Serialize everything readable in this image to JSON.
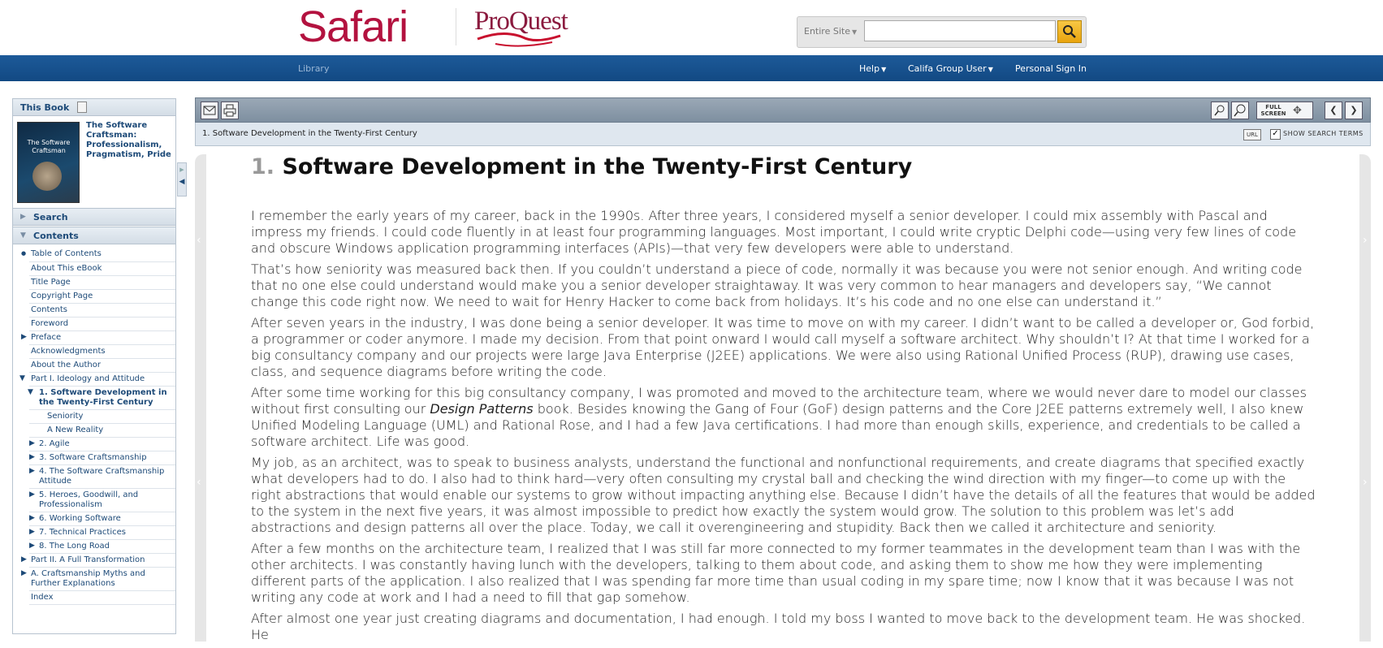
{
  "header": {
    "logo_safari": "Safari",
    "logo_proquest": "ProQuest",
    "search_scope": "Entire Site",
    "search_placeholder": ""
  },
  "nav": {
    "library": "Library",
    "help": "Help",
    "group": "Califa Group User",
    "signin": "Personal Sign In"
  },
  "sidebar": {
    "this_book": "This Book",
    "cover_title": "The Software Craftsman",
    "book_title": "The Software Craftsman: Professionalism, Pragmatism, Pride",
    "search_label": "Search",
    "contents_label": "Contents",
    "toc": [
      {
        "label": "Table of Contents"
      },
      {
        "label": "About This eBook"
      },
      {
        "label": "Title Page"
      },
      {
        "label": "Copyright Page"
      },
      {
        "label": "Contents"
      },
      {
        "label": "Foreword"
      },
      {
        "label": "Preface"
      },
      {
        "label": "Acknowledgments"
      },
      {
        "label": "About the Author"
      },
      {
        "label": "Part I. Ideology and Attitude"
      },
      {
        "label": "1. Software Development in the Twenty-First Century"
      },
      {
        "label": "Seniority"
      },
      {
        "label": "A New Reality"
      },
      {
        "label": "2. Agile"
      },
      {
        "label": "3. Software Craftsmanship"
      },
      {
        "label": "4. The Software Craftsmanship Attitude"
      },
      {
        "label": "5. Heroes, Goodwill, and Professionalism"
      },
      {
        "label": "6. Working Software"
      },
      {
        "label": "7. Technical Practices"
      },
      {
        "label": "8. The Long Road"
      },
      {
        "label": "Part II. A Full Transformation"
      },
      {
        "label": "A. Craftsmanship Myths and Further Explanations"
      },
      {
        "label": "Index"
      }
    ]
  },
  "toolbar": {
    "fullscreen": "FULL SCREEN",
    "breadcrumb": "1. Software Development in the Twenty-First Century",
    "url": "URL",
    "show_terms": "SHOW SEARCH TERMS"
  },
  "content": {
    "chapter_num": "1.",
    "chapter_title": "Software Development in the Twenty-First Century",
    "p1": "I remember the early years of my career, back in the 1990s. After three years, I considered myself a senior developer. I could mix assembly with Pascal and impress my friends. I could code fluently in at least four programming languages. Most important, I could write cryptic Delphi code—using very few lines of code and obscure Windows application programming interfaces (APIs)—that very few developers were able to understand.",
    "p2": "That’s how seniority was measured back then. If you couldn’t understand a piece of code, normally it was because you were not senior enough. And writing code that no one else could understand would make you a senior developer straightaway. It was very common to hear managers and developers say, “We cannot change this code right now. We need to wait for Henry Hacker to come back from holidays. It’s his code and no one else can understand it.”",
    "p3": "After seven years in the industry, I was done being a senior developer. It was time to move on with my career. I didn’t want to be called a developer or, God forbid, a programmer or coder anymore. I made my decision. From that point onward I would call myself a software architect. Why shouldn’t I? At that time I worked for a big consultancy company and our projects were large Java Enterprise (J2EE) applications. We were also using Rational Unified Process (RUP), drawing use cases, class, and sequence diagrams before writing the code.",
    "p4a": "After some time working for this big consultancy company, I was promoted and moved to the architecture team, where we would never dare to model our classes without first consulting our ",
    "p4_em": "Design Patterns",
    "p4b": " book. Besides knowing the Gang of Four (GoF) design patterns and the Core J2EE patterns extremely well, I also knew Unified Modeling Language (UML) and Rational Rose, and I had a few Java certifications. I had more than enough skills, experience, and credentials to be called a software architect. Life was good.",
    "p5": "My job, as an architect, was to speak to business analysts, understand the functional and nonfunctional requirements, and create diagrams that specified exactly what developers had to do. I also had to think hard—very often consulting my crystal ball and checking the wind direction with my finger—to come up with the right abstractions that would enable our systems to grow without impacting anything else. Because I didn’t have the details of all the features that would be added to the system in the next five years, it was almost impossible to predict how exactly the system would grow. The solution to this problem was let’s add abstractions and design patterns all over the place. Today, we call it overengineering and stupidity. Back then we called it architecture and seniority.",
    "p6": "After a few months on the architecture team, I realized that I was still far more connected to my former teammates in the development team than I was with the other architects. I was constantly having lunch with the developers, talking to them about code, and asking them to show me how they were implementing different parts of the application. I also realized that I was spending far more time than usual coding in my spare time; now I know that it was because I was not writing any code at work and I had a need to fill that gap somehow.",
    "p7": "After almost one year just creating diagrams and documentation, I had enough. I told my boss I wanted to move back to the development team. He was shocked. He"
  }
}
